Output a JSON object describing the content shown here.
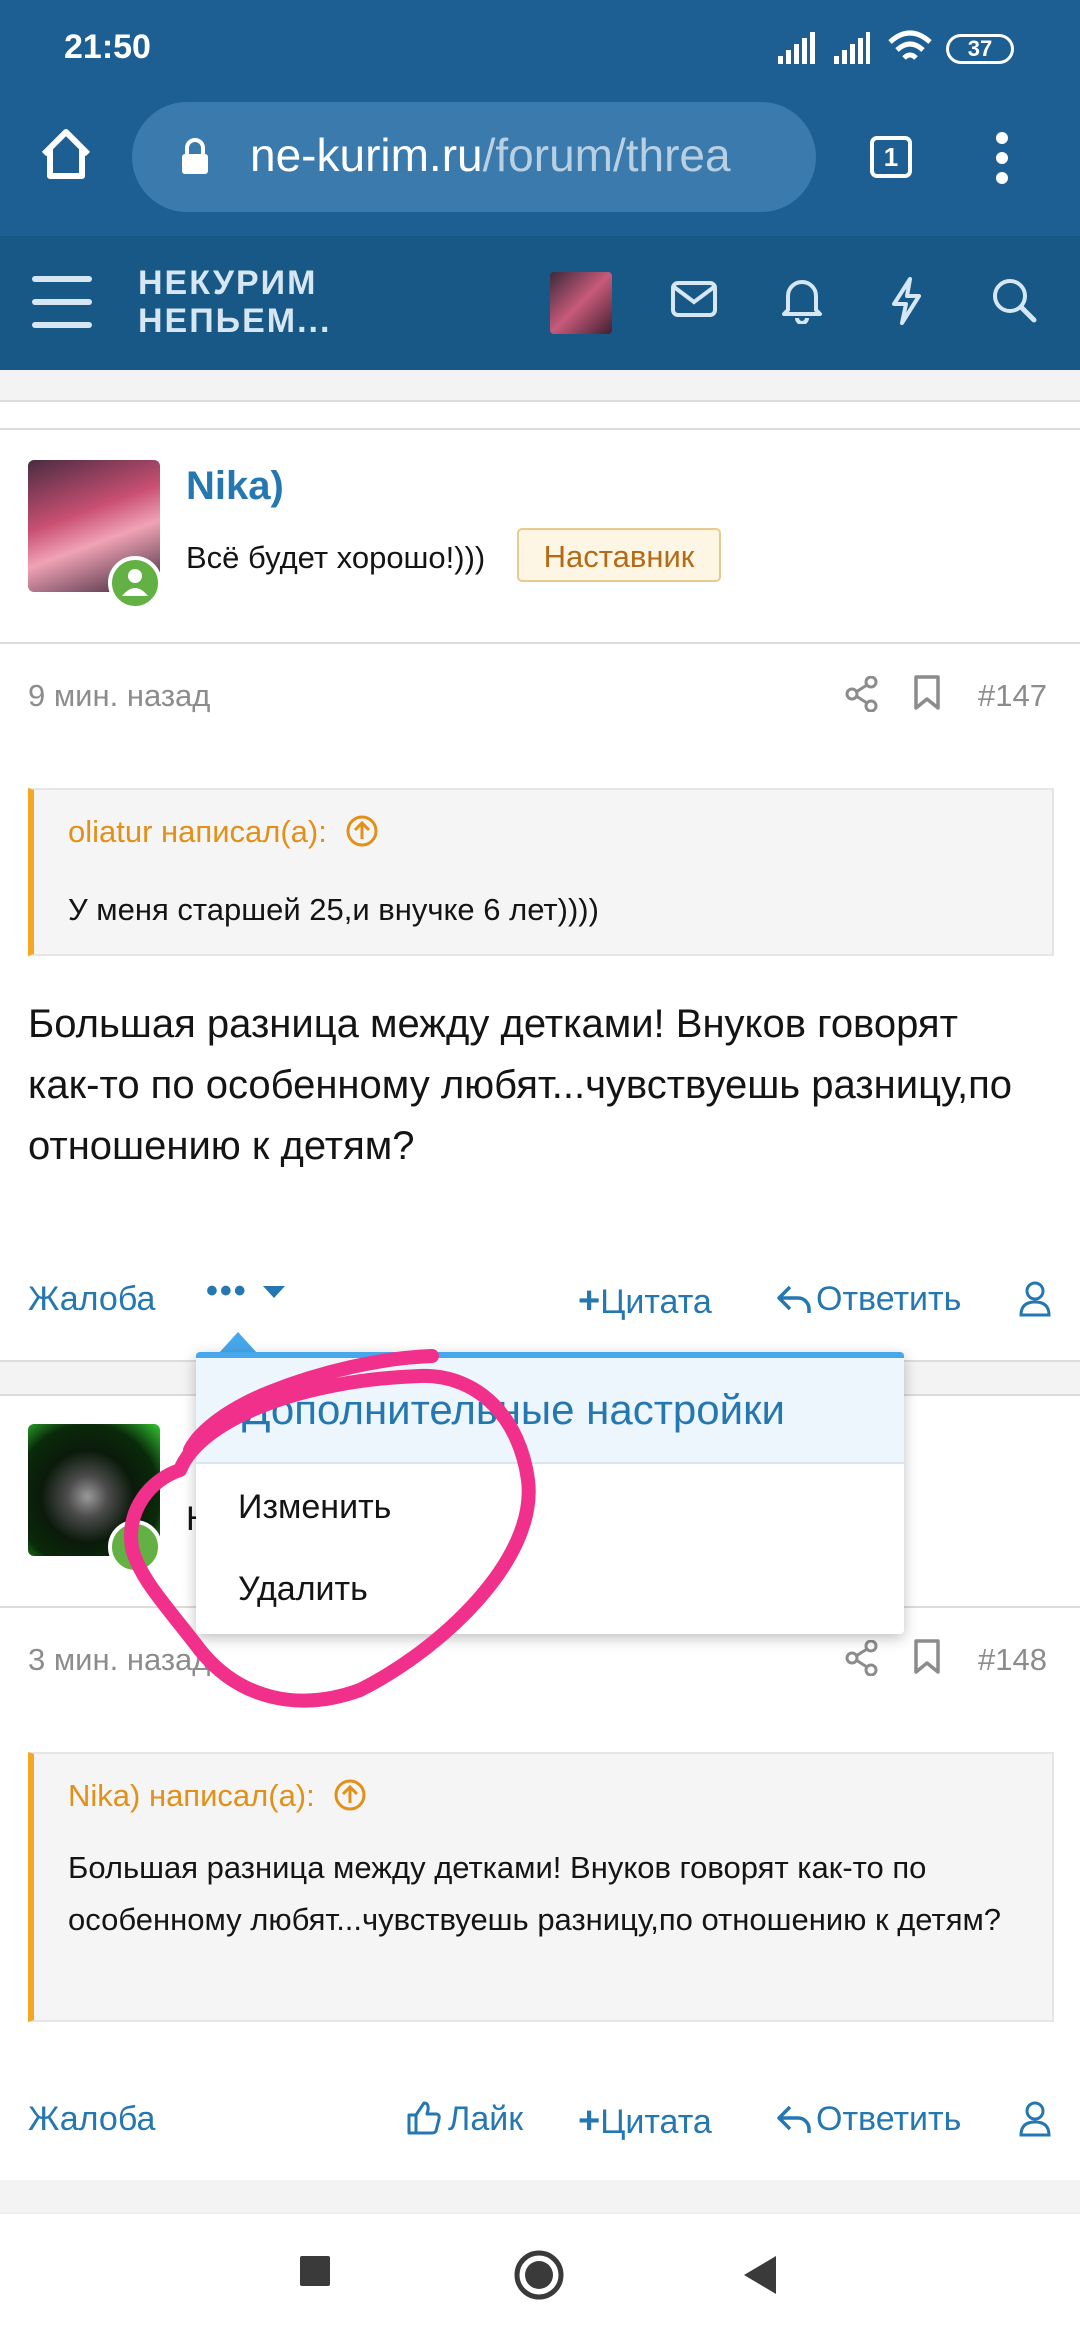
{
  "status_bar": {
    "time": "21:50",
    "battery": "37"
  },
  "browser": {
    "url_main": "ne-kurim.ru",
    "url_path": "/forum/threa",
    "tabs_count": "1"
  },
  "site": {
    "logo_line1": "НЕКУРИМ",
    "logo_line2": "НЕПЬЕМ..."
  },
  "posts": [
    {
      "username": "Nika)",
      "user_title": "Всё будет хорошо!)))",
      "badge": "Наставник",
      "time": "9 мин. назад",
      "number": "#147",
      "quote_author": "oliatur написал(а):",
      "quote_text": "У меня старшей 25,и внучке 6 лет))))",
      "body": "Большая разница между детками! Внуков говорят как-то по особенному любят...чувствуешь разницу,по отношению к детям?",
      "actions": {
        "report": "Жалоба",
        "more": "•••",
        "quote": "Цитата",
        "reply": "Ответить"
      }
    },
    {
      "username_partial": "Н",
      "time": "3 мин. назад",
      "number": "#148",
      "quote_author": "Nika) написал(а):",
      "quote_text": "Большая разница между детками! Внуков говорят как-то по особенному любят...чувствуешь разницу,по отношению к детям?",
      "actions": {
        "report": "Жалоба",
        "like": "Лайк",
        "quote": "Цитата",
        "reply": "Ответить"
      }
    }
  ],
  "dropdown": {
    "title": "Дополнительные настройки",
    "items": [
      "Изменить",
      "Удалить"
    ]
  },
  "colors": {
    "header": "#185886",
    "link": "#2577b1",
    "quote_accent": "#f5a623",
    "annotation": "#f0308a"
  }
}
